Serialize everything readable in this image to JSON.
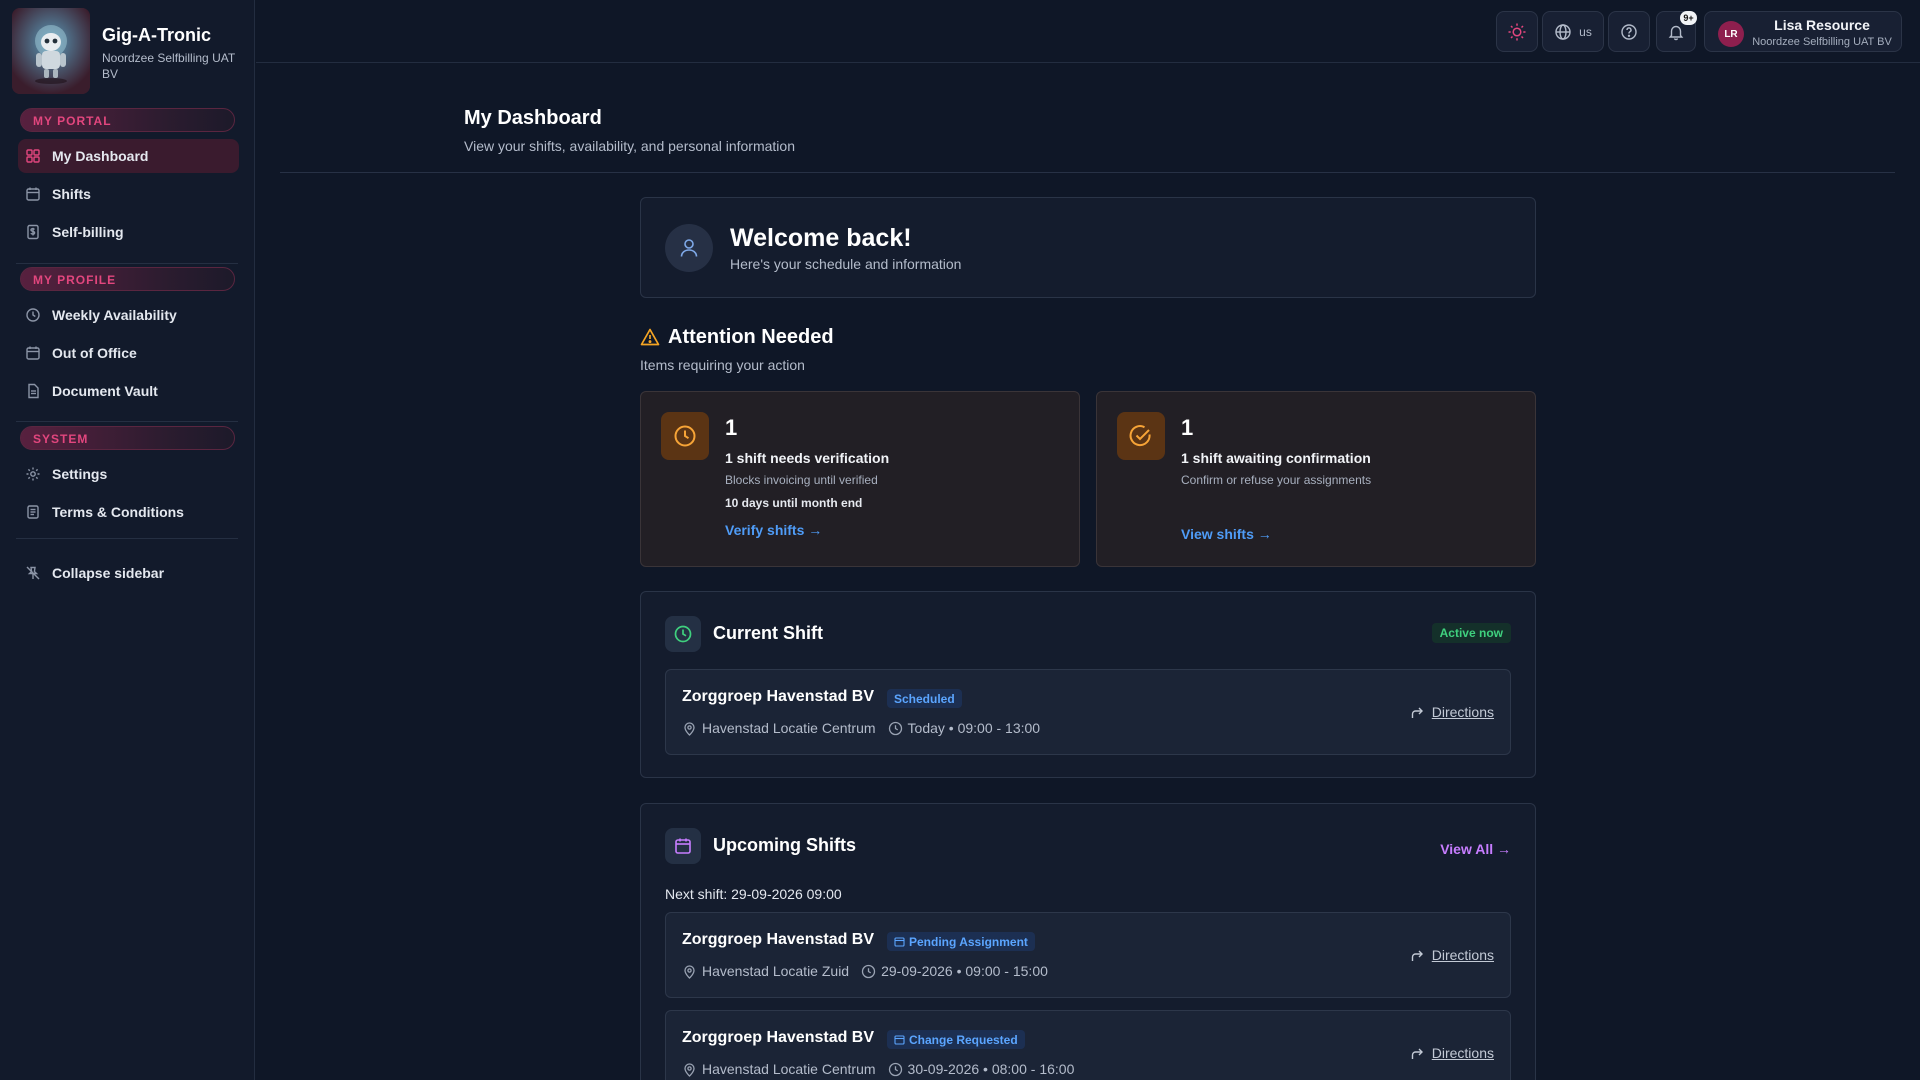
{
  "colors": {
    "background": "#0f1727",
    "sidebar": "#121a2b",
    "accent_pink": "#e2467e",
    "link_blue": "#4f9cf7",
    "warning_orange": "#f7a437",
    "success_green": "#3fd07e",
    "purple_link": "#c77dff"
  },
  "brand": {
    "name": "Gig-A-Tronic",
    "org": "Noordzee Selfbilling UAT BV",
    "logo_icon": "robot-mascot-icon"
  },
  "sidebar": {
    "sections": [
      {
        "label": "MY PORTAL",
        "items": [
          {
            "label": "My Dashboard",
            "icon": "dashboard-grid-icon",
            "active": true
          },
          {
            "label": "Shifts",
            "icon": "calendar-icon"
          },
          {
            "label": "Self-billing",
            "icon": "invoice-icon"
          }
        ]
      },
      {
        "label": "MY PROFILE",
        "items": [
          {
            "label": "Weekly Availability",
            "icon": "clock-icon"
          },
          {
            "label": "Out of Office",
            "icon": "calendar-icon"
          },
          {
            "label": "Document Vault",
            "icon": "document-icon"
          }
        ]
      },
      {
        "label": "SYSTEM",
        "items": [
          {
            "label": "Settings",
            "icon": "gear-icon"
          },
          {
            "label": "Terms & Conditions",
            "icon": "scroll-icon"
          }
        ]
      }
    ],
    "collapse_label": "Collapse sidebar"
  },
  "topbar": {
    "theme_icon": "sun-icon",
    "language": "us",
    "help_icon": "help-circle-icon",
    "notifications_badge": "9+",
    "user": {
      "initials": "LR",
      "name": "Lisa Resource",
      "org": "Noordzee Selfbilling UAT BV"
    }
  },
  "page": {
    "title": "My Dashboard",
    "subtitle": "View your shifts, availability, and personal information"
  },
  "welcome": {
    "title": "Welcome back!",
    "subtitle": "Here's your schedule and information"
  },
  "attention": {
    "title": "Attention Needed",
    "subtitle": "Items requiring your action",
    "cards": [
      {
        "count": "1",
        "title": "1 shift needs verification",
        "desc": "Blocks invoicing until verified",
        "note": "10 days until month end",
        "link": "Verify shifts →"
      },
      {
        "count": "1",
        "title": "1 shift awaiting confirmation",
        "desc": "Confirm or refuse your assignments",
        "link": "View shifts →"
      }
    ]
  },
  "current_shift": {
    "title": "Current Shift",
    "badge": "Active now",
    "shift": {
      "org": "Zorggroep Havenstad BV",
      "status": "Scheduled",
      "location": "Havenstad Locatie Centrum",
      "time": "Today • 09:00 - 13:00",
      "directions": "Directions"
    }
  },
  "upcoming": {
    "title": "Upcoming Shifts",
    "view_all": "View All →",
    "next_shift": "Next shift: 29-09-2026 09:00",
    "shifts": [
      {
        "org": "Zorggroep Havenstad BV",
        "status": "Pending Assignment",
        "location": "Havenstad Locatie Zuid",
        "time": "29-09-2026 • 09:00 - 15:00",
        "directions": "Directions"
      },
      {
        "org": "Zorggroep Havenstad BV",
        "status": "Change Requested",
        "location": "Havenstad Locatie Centrum",
        "time": "30-09-2026 • 08:00 - 16:00",
        "directions": "Directions"
      }
    ]
  }
}
